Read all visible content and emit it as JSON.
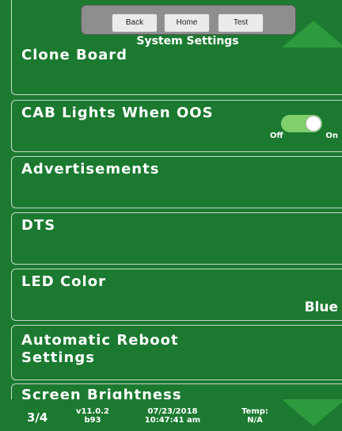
{
  "header": {
    "title": "System Settings",
    "buttons": {
      "back": "Back",
      "home": "Home",
      "test": "Test"
    }
  },
  "rows": [
    {
      "label": "Clone Board"
    },
    {
      "label": "CAB Lights When OOS",
      "toggle": {
        "off": "Off",
        "on": "On",
        "state": "on"
      }
    },
    {
      "label": "Advertisements"
    },
    {
      "label": "DTS"
    },
    {
      "label": "LED Color",
      "value": "Blue"
    },
    {
      "label_line1": "Automatic Reboot",
      "label_line2": "Settings"
    },
    {
      "label": "Screen Brightness"
    }
  ],
  "footer": {
    "page": "3/4",
    "version": "v11.0.2",
    "build": "b93",
    "date": "07/23/2018",
    "time": "10:47:41 am",
    "temp_label": "Temp:",
    "temp_value": "N/A"
  },
  "icons": {
    "scroll_up": "arrow-up-icon",
    "scroll_down": "arrow-down-icon",
    "toggle_knob": "toggle-knob"
  },
  "colors": {
    "background": "#1b7a30",
    "arrow": "#2e9a3e",
    "toggle_on": "#7fcf6c",
    "header_bar": "#8e8e8e"
  }
}
